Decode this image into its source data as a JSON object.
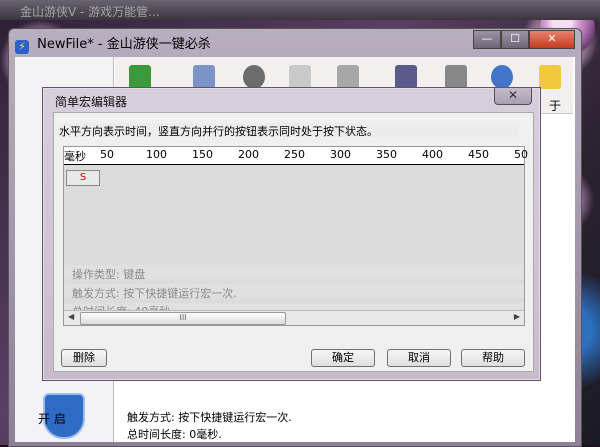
{
  "background_window": {
    "title": "金山游侠V - 游戏万能管..."
  },
  "main_window": {
    "title": "NewFile* - 金山游侠一键必杀",
    "buttons": {
      "min": "—",
      "max": "☐",
      "close": "✕"
    },
    "left_pane": {
      "start_label": "开 启"
    },
    "toolbar_partial": "于",
    "status": {
      "line1": "触发方式:  按下快捷键运行宏一次.",
      "line2": "总时间长度:  0毫秒."
    }
  },
  "dialog": {
    "title": "简单宏编辑器",
    "close": "✕",
    "hint": "水平方向表示时间，竖直方向并行的按钮表示同时处于按下状态。",
    "ruler": {
      "unit": "毫秒",
      "ticks": [
        "50",
        "100",
        "150",
        "200",
        "250",
        "300",
        "350",
        "400",
        "450",
        "50"
      ]
    },
    "key_button": "S",
    "info": {
      "type": "操作类型:  键盘",
      "trigger": "触发方式:  按下快捷键运行宏一次.",
      "duration": "总时间长度:  40毫秒"
    },
    "scroll_grip": "III",
    "buttons": {
      "delete": "删除",
      "ok": "确定",
      "cancel": "取消",
      "help": "帮助"
    }
  }
}
